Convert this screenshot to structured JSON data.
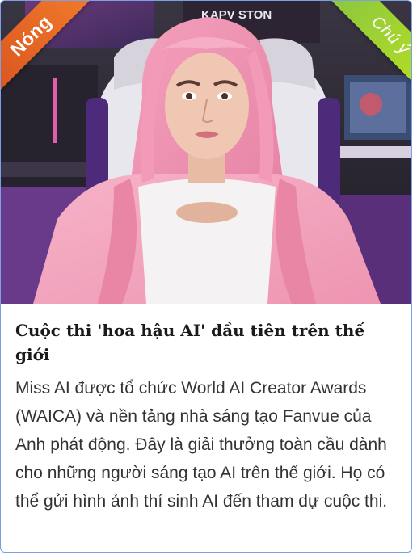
{
  "card": {
    "badge_hot": "Nóng",
    "badge_note": "Chú ý",
    "image_alt": "Người mẫu AI tóc hồng ngồi trên ghế gaming",
    "title": "Cuộc thi 'hoa hậu AI' đầu tiên trên thế giới",
    "description": "Miss AI được tổ chức World AI Creator Awards (WAICA) và nền tảng nhà sáng tạo Fanvue của Anh phát động. Đây là giải thưởng toàn cầu dành cho những người sáng tạo AI trên thế giới. Họ có thể gửi hình ảnh thí sinh AI đến tham dự cuộc thi.",
    "sign_text": "KAPV STON"
  },
  "colors": {
    "hot_ribbon": "#e0622a",
    "note_ribbon": "#a4d12e",
    "card_border": "#7aa0e6"
  }
}
